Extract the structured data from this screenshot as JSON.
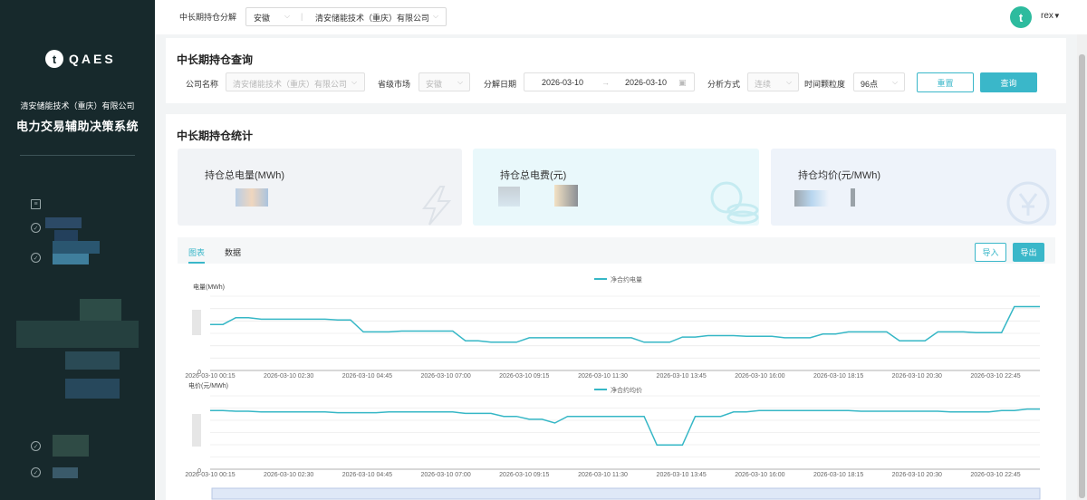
{
  "sidebar": {
    "logo_text": "QAES",
    "logo_mark_icon": "plant-icon",
    "company_name": "清安储能技术（重庆）有限公司",
    "system_name": "电力交易辅助决策系统"
  },
  "topbar": {
    "module_label": "中长期持仓分解",
    "province": "安徽",
    "company": "清安储能技术（重庆）有限公司",
    "user_name": "rex"
  },
  "query": {
    "title": "中长期持仓查询",
    "company_label": "公司名称",
    "company_value": "清安储能技术（重庆）有限公司",
    "province_label": "省级市场",
    "province_value": "安徽",
    "date_label": "分解日期",
    "start_date": "2026-03-10",
    "end_date": "2026-03-10",
    "date_separator": "→",
    "method_label": "分析方式",
    "method_value": "连续",
    "granularity_label": "时间颗粒度",
    "granularity_value": "96点",
    "reset_label": "重置",
    "query_label": "查询"
  },
  "stats": {
    "title": "中长期持仓统计",
    "cards": [
      {
        "label": "持仓总电量(MWh)",
        "icon": "lightning-icon"
      },
      {
        "label": "持仓总电费(元)",
        "icon": "coins-icon"
      },
      {
        "label": "持仓均价(元/MWh)",
        "icon": "yen-icon"
      }
    ]
  },
  "tabs": {
    "chart_label": "图表",
    "data_label": "数据",
    "import_label": "导入",
    "export_label": "导出"
  },
  "colors": {
    "accent": "#3ab7c9",
    "sidebar": "#17292c",
    "line": "#36b7c6"
  },
  "chart_data": [
    {
      "type": "line",
      "ylabel": "电量(MWh)",
      "series": [
        {
          "name": "净合约电量",
          "values": [
            0.62,
            0.62,
            0.71,
            0.71,
            0.69,
            0.69,
            0.69,
            0.69,
            0.69,
            0.69,
            0.68,
            0.68,
            0.52,
            0.52,
            0.52,
            0.53,
            0.53,
            0.53,
            0.53,
            0.53,
            0.4,
            0.4,
            0.38,
            0.38,
            0.38,
            0.44,
            0.44,
            0.44,
            0.44,
            0.44,
            0.44,
            0.44,
            0.44,
            0.44,
            0.38,
            0.38,
            0.38,
            0.45,
            0.45,
            0.47,
            0.47,
            0.47,
            0.46,
            0.46,
            0.46,
            0.44,
            0.44,
            0.44,
            0.49,
            0.49,
            0.52,
            0.52,
            0.52,
            0.52,
            0.4,
            0.4,
            0.4,
            0.52,
            0.52,
            0.52,
            0.51,
            0.51,
            0.51,
            0.86,
            0.86,
            0.86
          ]
        }
      ],
      "x_ticks": [
        "2026-03-10 00:15",
        "2026-03-10 02:30",
        "2026-03-10 04:45",
        "2026-03-10 07:00",
        "2026-03-10 09:15",
        "2026-03-10 11:30",
        "2026-03-10 13:45",
        "2026-03-10 16:00",
        "2026-03-10 18:15",
        "2026-03-10 20:30",
        "2026-03-10 22:45"
      ],
      "y_ticks": [
        "0"
      ]
    },
    {
      "type": "line",
      "ylabel": "电价(元/MWh)",
      "series": [
        {
          "name": "净合约均价",
          "values": [
            0.8,
            0.8,
            0.79,
            0.79,
            0.78,
            0.78,
            0.78,
            0.78,
            0.78,
            0.78,
            0.77,
            0.77,
            0.77,
            0.77,
            0.78,
            0.78,
            0.78,
            0.78,
            0.78,
            0.78,
            0.76,
            0.76,
            0.76,
            0.72,
            0.72,
            0.68,
            0.68,
            0.63,
            0.72,
            0.72,
            0.72,
            0.72,
            0.72,
            0.72,
            0.72,
            0.33,
            0.33,
            0.33,
            0.72,
            0.72,
            0.72,
            0.78,
            0.78,
            0.8,
            0.8,
            0.8,
            0.8,
            0.8,
            0.8,
            0.8,
            0.8,
            0.79,
            0.79,
            0.79,
            0.79,
            0.79,
            0.79,
            0.79,
            0.78,
            0.78,
            0.78,
            0.78,
            0.8,
            0.8,
            0.82,
            0.82
          ]
        }
      ],
      "x_ticks": [
        "2026-03-10 00:15",
        "2026-03-10 02:30",
        "2026-03-10 04:45",
        "2026-03-10 07:00",
        "2026-03-10 09:15",
        "2026-03-10 11:30",
        "2026-03-10 13:45",
        "2026-03-10 16:00",
        "2026-03-10 18:15",
        "2026-03-10 20:30",
        "2026-03-10 22:45"
      ],
      "y_ticks": [
        "0"
      ]
    }
  ]
}
